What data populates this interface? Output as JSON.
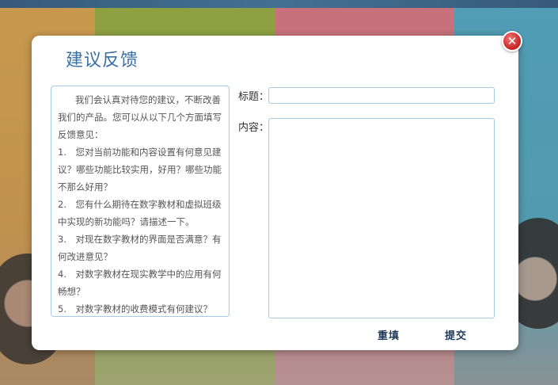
{
  "dialog": {
    "title": "建议反馈",
    "close_icon": "close-icon",
    "close_glyph": "✕",
    "tips": {
      "intro": "我们会认真对待您的建议，不断改善我们的产品。您可以从以下几个方面填写反馈意见：",
      "items": [
        "1.　您对当前功能和内容设置有何意见建议？哪些功能比较实用，好用？哪些功能不那么好用？",
        "2.　您有什么期待在数字教材和虚拟班级中实现的新功能吗？请描述一下。",
        "3.　对现在数字教材的界面是否满意？有何改进意见？",
        "4.　对数字教材在现实教学中的应用有何畅想？",
        "5.　对数字教材的收费模式有何建议？"
      ]
    },
    "form": {
      "title_label": "标题：",
      "title_value": "",
      "content_label": "内容：",
      "content_value": ""
    },
    "buttons": {
      "reset_label": "重填",
      "submit_label": "提交"
    }
  },
  "colors": {
    "title": "#3a6fa5",
    "border": "#a9c9e6",
    "close": "#c81f1f"
  }
}
